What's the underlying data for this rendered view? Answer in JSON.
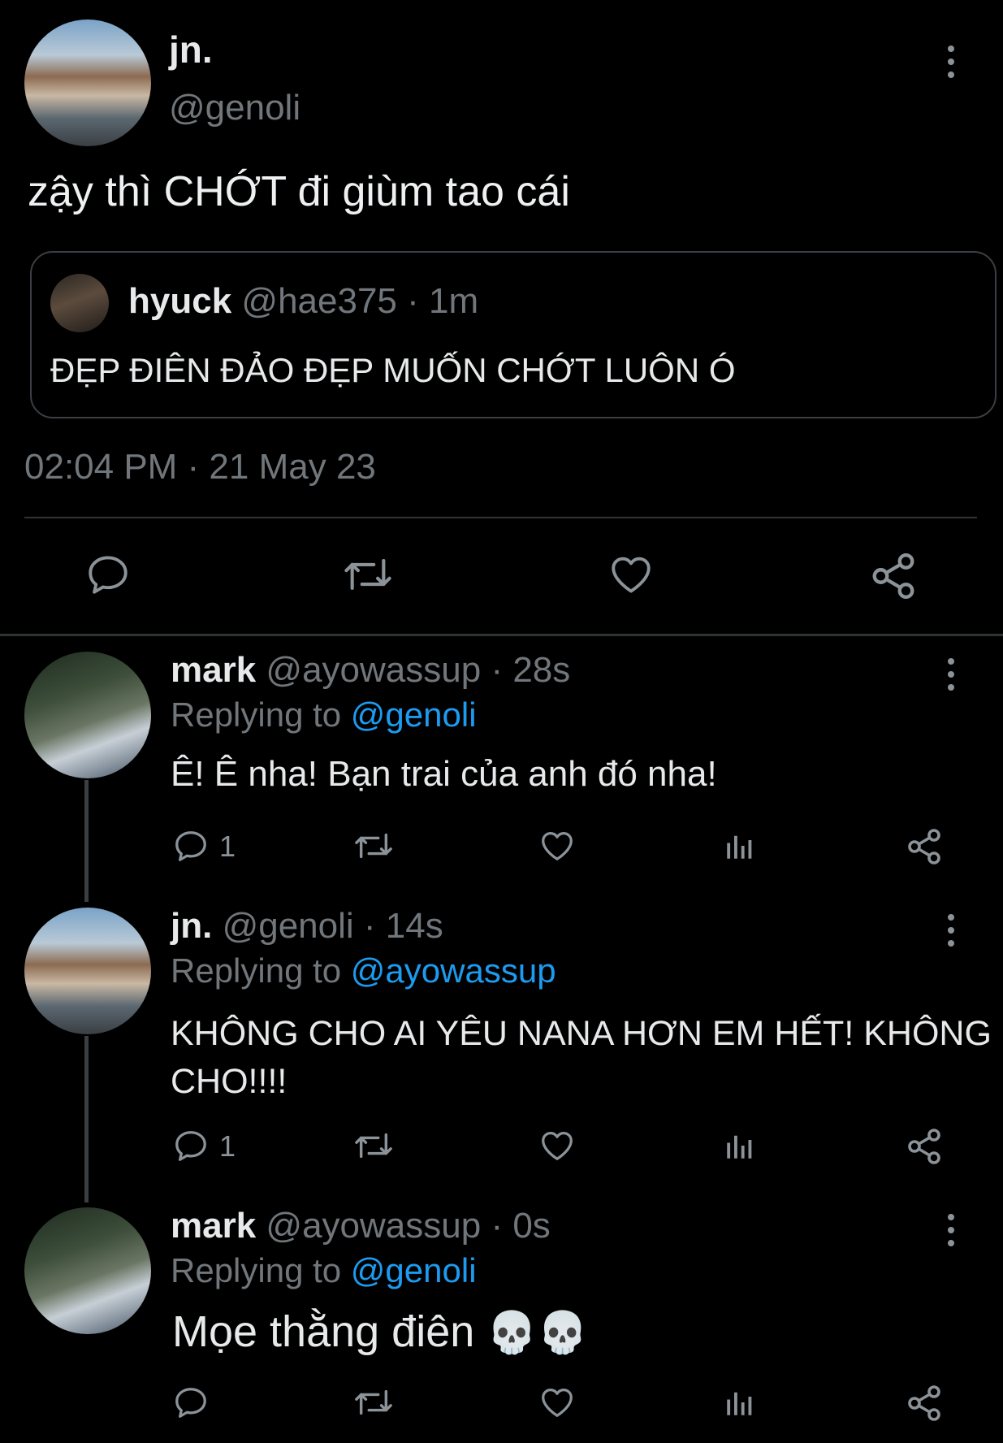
{
  "main_tweet": {
    "display_name": "jn.",
    "handle": "@genoli",
    "text": "zậy thì CHỚT đi giùm tao cái",
    "quoted": {
      "display_name": "hyuck",
      "handle": "@hae375",
      "time": "· 1m",
      "text": "ĐẸP ĐIÊN ĐẢO ĐẸP MUỐN CHỚT LUÔN Ó"
    },
    "timestamp": "02:04 PM · 21 May 23"
  },
  "replies": [
    {
      "display_name": "mark",
      "handle": "@ayowassup",
      "time": "· 28s",
      "replying_prefix": "Replying to",
      "replying_to": "@genoli",
      "text": "Ê! Ê nha! Bạn trai của anh đó nha!",
      "reply_count": "1"
    },
    {
      "display_name": "jn.",
      "handle": "@genoli",
      "time": "· 14s",
      "replying_prefix": "Replying to",
      "replying_to": "@ayowassup",
      "text_line1": "KHÔNG CHO AI YÊU NANA HƠN EM HẾT! KHÔNG",
      "text_line2": "CHO!!!!",
      "reply_count": "1"
    },
    {
      "display_name": "mark",
      "handle": "@ayowassup",
      "time": "· 0s",
      "replying_prefix": "Replying to",
      "replying_to": "@genoli",
      "text": "Mọe thằng điên",
      "emoji": "💀💀"
    }
  ],
  "icons": {
    "reply": "reply-icon",
    "retweet": "retweet-icon",
    "like": "heart-icon",
    "views": "views-icon",
    "share": "share-icon",
    "more": "more-icon"
  },
  "colors": {
    "background": "#000000",
    "text": "#e7e9ea",
    "muted": "#71767b",
    "link": "#1d9bf0",
    "border": "#2f3336"
  }
}
